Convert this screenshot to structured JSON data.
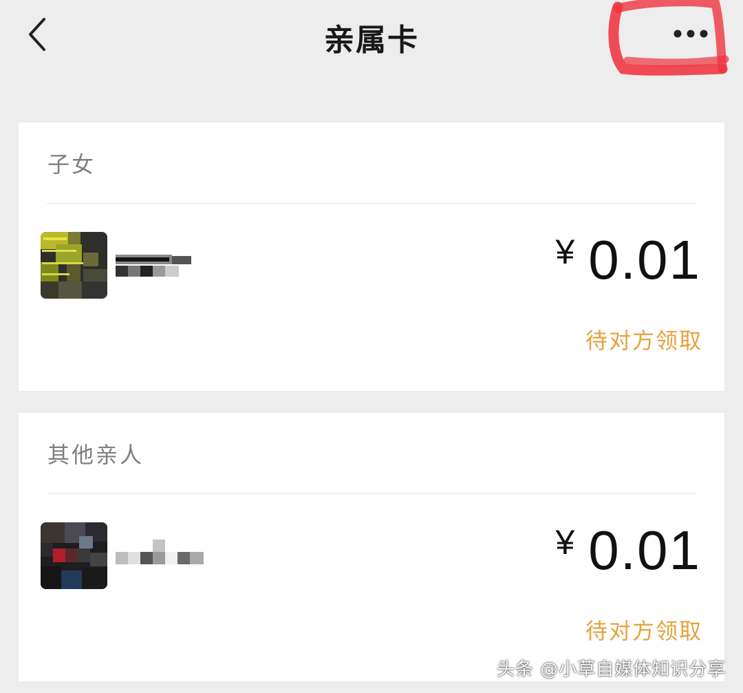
{
  "nav": {
    "title": "亲属卡"
  },
  "sections": [
    {
      "title": "子女",
      "member": {
        "amount": "0.01",
        "currency": "¥",
        "status": "待对方领取"
      }
    },
    {
      "title": "其他亲人",
      "member": {
        "amount": "0.01",
        "currency": "¥",
        "status": "待对方领取"
      }
    }
  ],
  "colors": {
    "background": "#ededed",
    "card": "#ffffff",
    "status": "#e6a23c",
    "annotation": "#ef3340"
  },
  "watermark": "头条 @小草自媒体知识分享"
}
